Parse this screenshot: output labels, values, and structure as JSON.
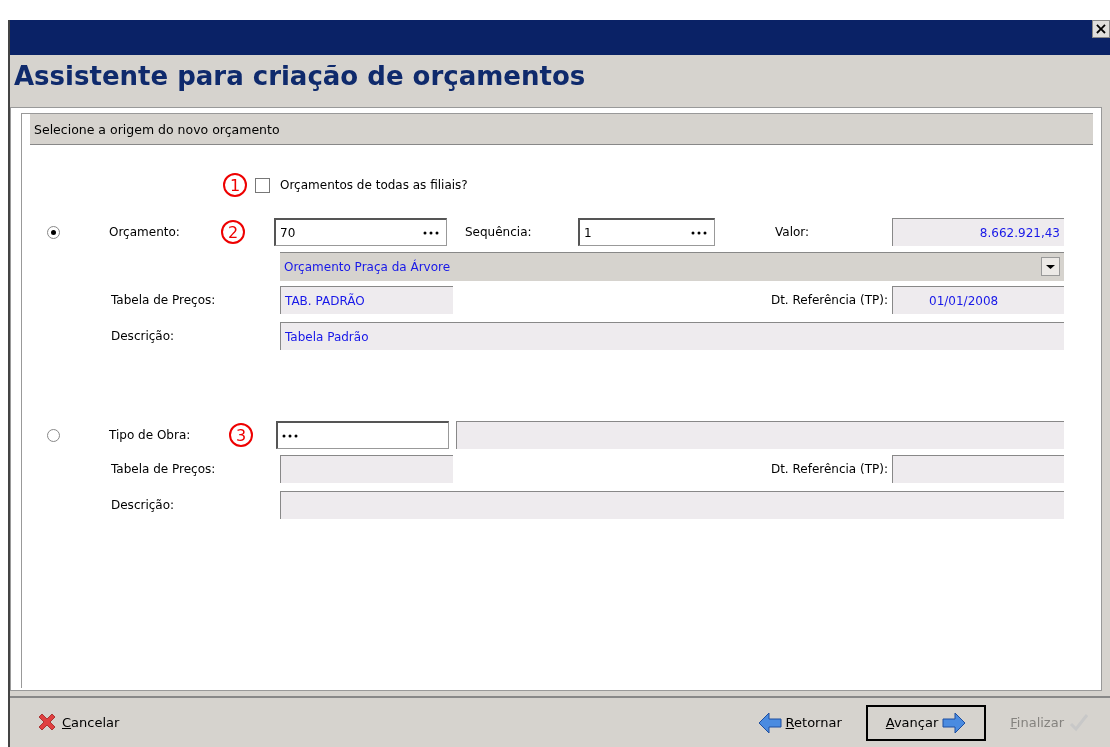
{
  "window": {
    "close": "×",
    "title": "Assistente para criação de orçamentos"
  },
  "group": {
    "title": "Selecione a origem do novo orçamento"
  },
  "all_branches": {
    "marker": "1",
    "label": "Orçamentos de todas as filiais?",
    "checked": false
  },
  "budget_source": {
    "selected": true,
    "label": "Orçamento:",
    "marker": "2",
    "value": "70",
    "sequence_label": "Sequência:",
    "sequence_value": "1",
    "amount_label": "Valor:",
    "amount_value": "8.662.921,43",
    "budget_name": "Orçamento Praça da Árvore",
    "price_table_label": "Tabela de Preços:",
    "price_table_value": "TAB. PADRÃO",
    "ref_date_label": "Dt. Referência (TP):",
    "ref_date_value": "01/01/2008",
    "description_label": "Descrição:",
    "description_value": "Tabela Padrão"
  },
  "work_type_source": {
    "selected": false,
    "label": "Tipo de Obra:",
    "marker": "3",
    "price_table_label": "Tabela de Preços:",
    "ref_date_label": "Dt. Referência (TP):",
    "description_label": "Descrição:"
  },
  "buttons": [
    {
      "label": "Cancelar",
      "kind": "cancel",
      "disabled": false,
      "focused": false
    },
    {
      "label": "Retornar",
      "kind": "back",
      "disabled": false,
      "focused": false
    },
    {
      "label": "Avançar",
      "kind": "next",
      "disabled": false,
      "focused": true
    },
    {
      "label": "Finalizar",
      "kind": "finish",
      "disabled": true,
      "focused": false
    }
  ]
}
